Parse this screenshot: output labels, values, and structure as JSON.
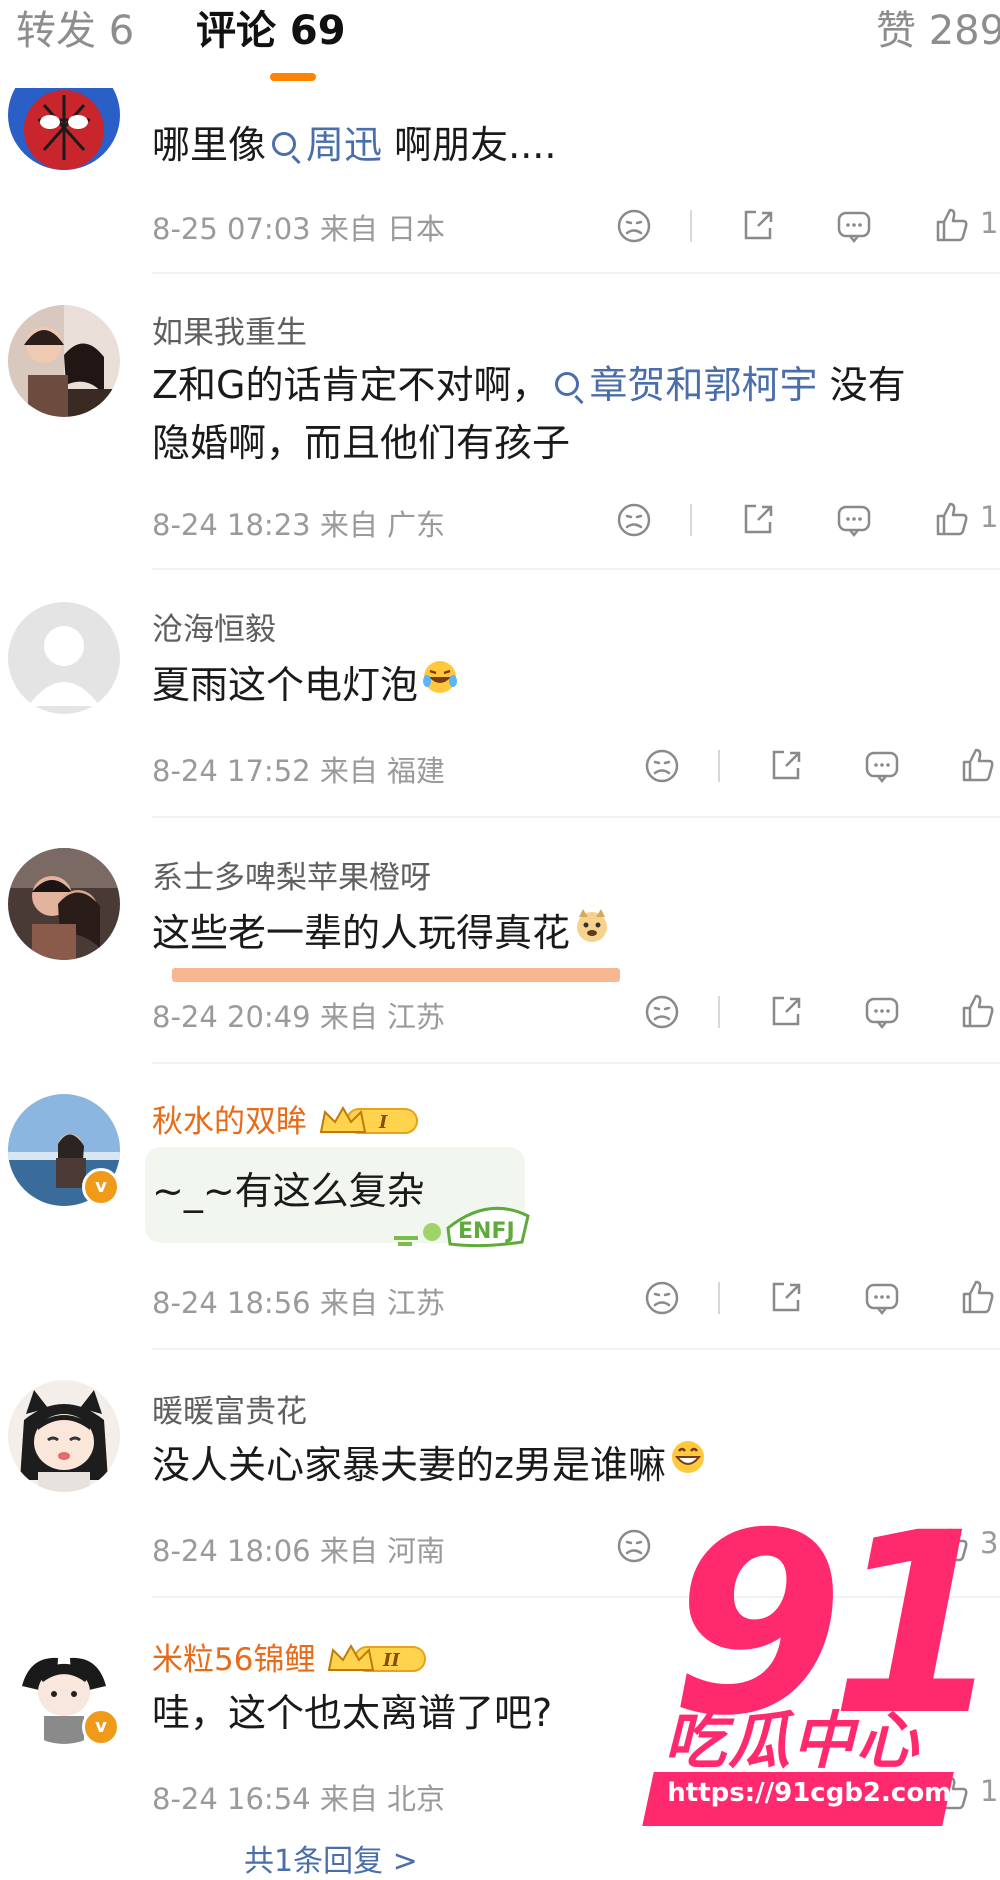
{
  "tabs": {
    "repost": "转发 6",
    "comments": "评论 69",
    "likes": "赞 289"
  },
  "icons": [
    "dislike-icon",
    "share-icon",
    "reply-icon",
    "like-icon",
    "search-icon"
  ],
  "colors": {
    "accent": "#ff8200",
    "topic": "#4a6ea9",
    "vip_name": "#e86b18",
    "meta": "#9a9a9a",
    "watermark": "#ff2a6d"
  },
  "comments": [
    {
      "name": "",
      "text_before": "哪里像",
      "topic": "周迅",
      "text_after": " 啊朋友....",
      "meta": "8-25 07:03 来自 日本",
      "likes": "1"
    },
    {
      "name": "如果我重生",
      "line1_before": "Z和G的话肯定不对啊，",
      "topic": "章贺和郭柯宇",
      "line1_after": " 没有",
      "line2": "隐婚啊，而且他们有孩子",
      "meta": "8-24 18:23 来自 广东",
      "likes": "1"
    },
    {
      "name": "沧海恒毅",
      "text": "夏雨这个电灯泡",
      "meta": "8-24 17:52 来自 福建"
    },
    {
      "name": "系士多啤梨苹果橙呀",
      "text": "这些老一辈的人玩得真花",
      "meta": "8-24 20:49 来自 江苏"
    },
    {
      "name": "秋水的双眸",
      "badge_level": "I",
      "text": "~_~有这么复杂",
      "sticker_text": "ENFJ",
      "meta": "8-24 18:56 来自 江苏"
    },
    {
      "name": "暖暖富贵花",
      "text": "没人关心家暴夫妻的z男是谁嘛",
      "meta": "8-24 18:06 来自 河南",
      "likes": "3"
    },
    {
      "name": "米粒56锦鲤",
      "badge_level": "II",
      "text": "哇，这个也太离谱了吧?",
      "meta": "8-24 16:54 来自 北京",
      "likes": "1",
      "more_replies": "共1条回复 >"
    }
  ],
  "watermark": {
    "number": "91",
    "title": "吃瓜中心",
    "url": "https://91cgb2.com"
  }
}
